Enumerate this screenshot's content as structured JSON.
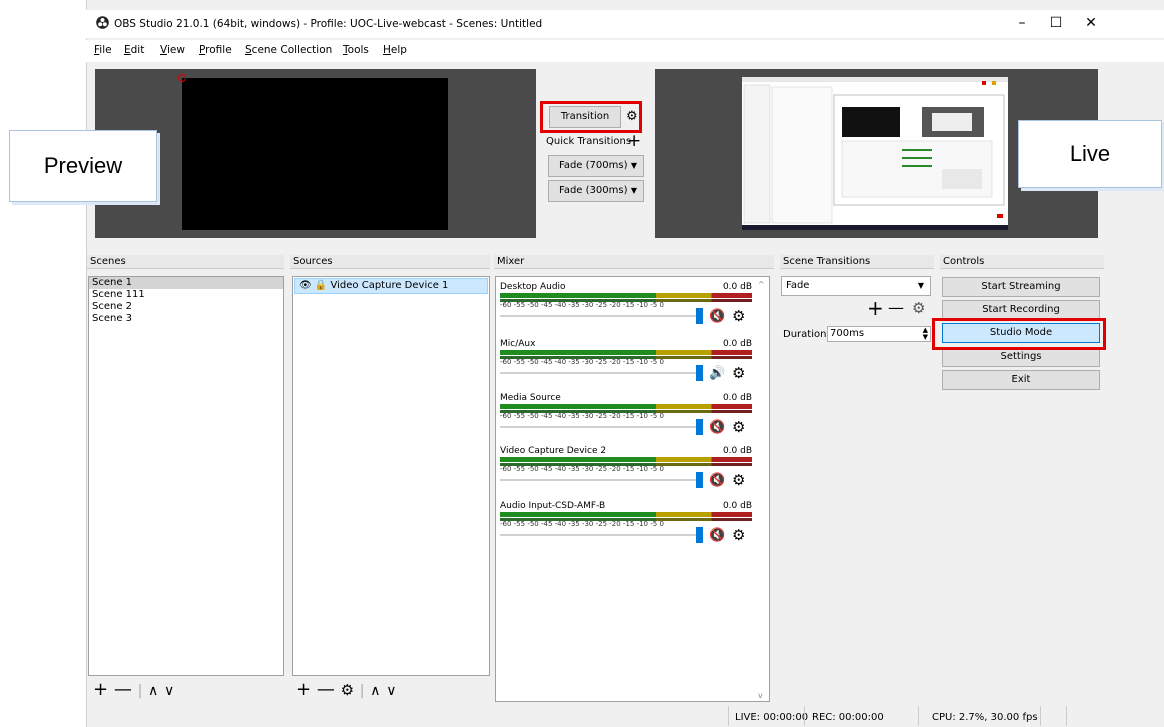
{
  "window": {
    "title": "OBS Studio 21.0.1 (64bit, windows) - Profile: UOC-Live-webcast - Scenes: Untitled",
    "controls": [
      "–",
      "☐",
      "✕"
    ]
  },
  "menu": [
    "File",
    "Edit",
    "View",
    "Profile",
    "Scene Collection",
    "Tools",
    "Help"
  ],
  "annotations": {
    "preview": "Preview",
    "live": "Live"
  },
  "transition_panel": {
    "transition_label": "Transition",
    "quick_transitions_label": "Quick Transitions",
    "quick": [
      "Fade (700ms)",
      "Fade (300ms)"
    ]
  },
  "docks": {
    "scenes": {
      "title": "Scenes",
      "items": [
        "Scene 1",
        "Scene 111",
        "Scene 2",
        "Scene 3"
      ],
      "selected": "Scene 1"
    },
    "sources": {
      "title": "Sources",
      "items": [
        "Video Capture Device 1"
      ]
    },
    "mixer": {
      "title": "Mixer",
      "tick_labels": "-60  -55  -50  -45  -40  -35  -30  -25  -20  -15  -10  -5  0",
      "channels": [
        {
          "name": "Desktop Audio",
          "db": "0.0 dB",
          "muted": true
        },
        {
          "name": "Mic/Aux",
          "db": "0.0 dB",
          "muted": false
        },
        {
          "name": "Media Source",
          "db": "0.0 dB",
          "muted": true
        },
        {
          "name": "Video Capture Device 2",
          "db": "0.0 dB",
          "muted": true
        },
        {
          "name": "Audio Input-CSD-AMF-B",
          "db": "0.0 dB",
          "muted": true
        }
      ]
    },
    "scene_transitions": {
      "title": "Scene Transitions",
      "selected": "Fade",
      "duration_label": "Duration",
      "duration_value": "700ms"
    },
    "controls": {
      "title": "Controls",
      "buttons": [
        "Start Streaming",
        "Start Recording",
        "Studio Mode",
        "Settings",
        "Exit"
      ],
      "highlighted": "Studio Mode"
    }
  },
  "status": {
    "live": "LIVE: 00:00:00",
    "rec": "REC: 00:00:00",
    "cpu": "CPU: 2.7%, 30.00 fps"
  },
  "colors": {
    "highlight": "#e00000",
    "selected_button": "#cce8ff",
    "slider": "#0078d7"
  },
  "icons": [
    "obs-logo-icon",
    "gear-icon",
    "plus-icon",
    "minus-icon",
    "chevron-up-icon",
    "chevron-down-icon",
    "eye-icon",
    "lock-icon",
    "mute-icon",
    "speaker-icon"
  ]
}
